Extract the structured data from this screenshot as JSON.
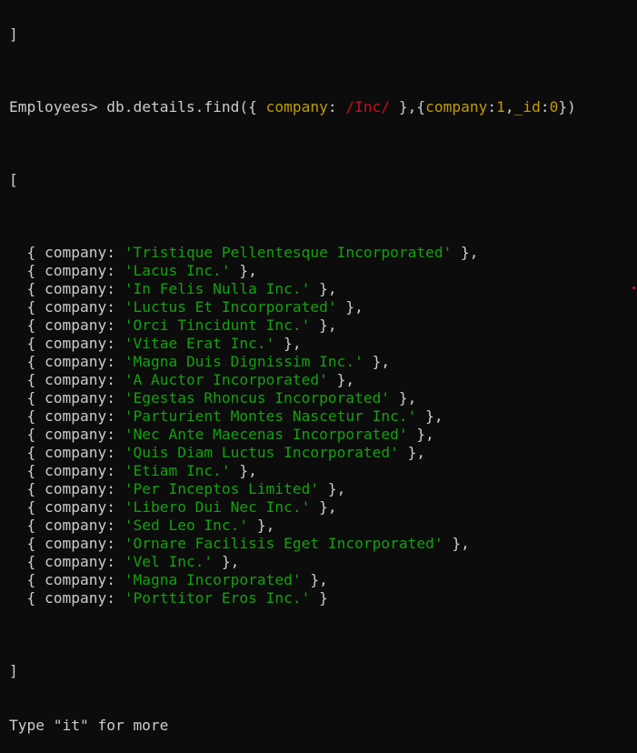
{
  "terminal": {
    "top_fragment": "]",
    "prompt": "Employees>",
    "command": {
      "head": "db.details.find({ ",
      "query_key": "company",
      "query_colon": ": ",
      "query_regex": "/Inc/",
      "query_mid": " },{",
      "proj_key1": "company",
      "proj_colon1": ":",
      "proj_val1": "1",
      "proj_comma": ",",
      "proj_key2": "_id",
      "proj_colon2": ":",
      "proj_val2": "0",
      "tail": "})"
    },
    "open_bracket": "[",
    "close_bracket": "]",
    "field_label": "company",
    "results": [
      "'Tristique Pellentesque Incorporated'",
      "'Lacus Inc.'",
      "'In Felis Nulla Inc.'",
      "'Luctus Et Incorporated'",
      "'Orci Tincidunt Inc.'",
      "'Vitae Erat Inc.'",
      "'Magna Duis Dignissim Inc.'",
      "'A Auctor Incorporated'",
      "'Egestas Rhoncus Incorporated'",
      "'Parturient Montes Nascetur Inc.'",
      "'Nec Ante Maecenas Incorporated'",
      "'Quis Diam Luctus Incorporated'",
      "'Etiam Inc.'",
      "'Per Inceptos Limited'",
      "'Libero Dui Nec Inc.'",
      "'Sed Leo Inc.'",
      "'Ornare Facilisis Eget Incorporated'",
      "'Vel Inc.'",
      "'Magna Incorporated'",
      "'Porttitor Eros Inc.'"
    ],
    "footer": "Type \"it\" for more"
  },
  "colors": {
    "background": "#0c0c0c",
    "text": "#cccccc",
    "key": "#c19c00",
    "regex": "#c50f1f",
    "string": "#13a10e",
    "dot": "#e81123"
  }
}
